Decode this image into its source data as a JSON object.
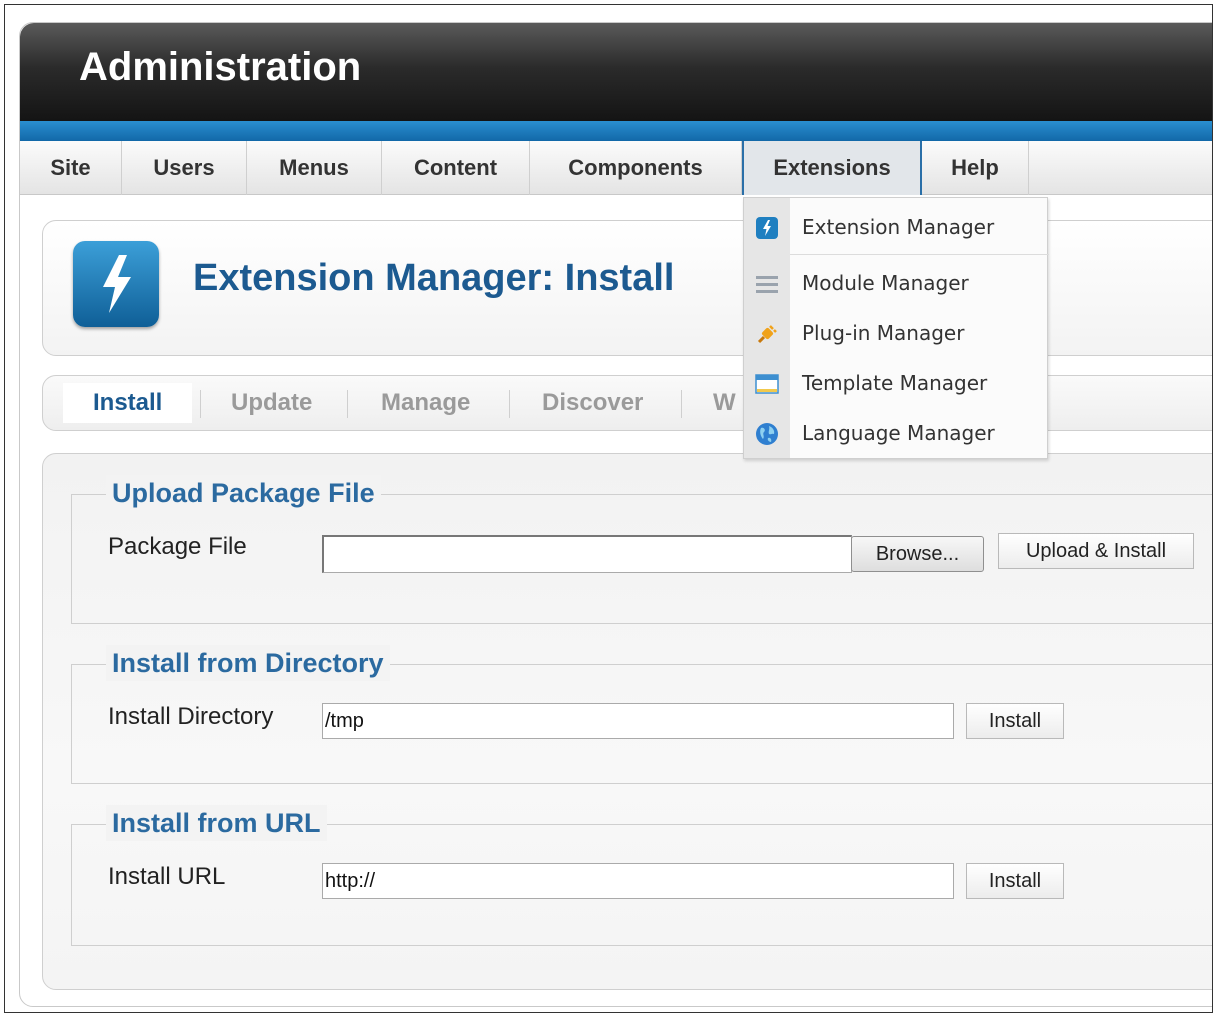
{
  "header": {
    "title": "Administration"
  },
  "menu": {
    "items": [
      "Site",
      "Users",
      "Menus",
      "Content",
      "Components",
      "Extensions",
      "Help"
    ],
    "active": "Extensions"
  },
  "dropdown": {
    "items": [
      {
        "label": "Extension Manager",
        "icon": "lightning-icon"
      },
      {
        "label": "Module Manager",
        "icon": "list-icon"
      },
      {
        "label": "Plug-in Manager",
        "icon": "plug-icon"
      },
      {
        "label": "Template Manager",
        "icon": "window-icon"
      },
      {
        "label": "Language Manager",
        "icon": "globe-icon"
      }
    ]
  },
  "page": {
    "title": "Extension Manager: Install",
    "icon": "lightning-icon"
  },
  "subtabs": {
    "items": [
      "Install",
      "Update",
      "Manage",
      "Discover",
      "W"
    ],
    "active": "Install"
  },
  "upload": {
    "legend": "Upload Package File",
    "label": "Package File",
    "value": "",
    "browse_label": "Browse...",
    "button_label": "Upload & Install"
  },
  "directory": {
    "legend": "Install from Directory",
    "label": "Install Directory",
    "value": "/tmp",
    "button_label": "Install"
  },
  "url": {
    "legend": "Install from URL",
    "label": "Install URL",
    "value": "http://",
    "button_label": "Install"
  },
  "colors": {
    "header_dark": "#141414",
    "accent_blue": "#1c5a90",
    "bar_blue": "#1a7abd",
    "legend_blue": "#2b6aa0"
  }
}
